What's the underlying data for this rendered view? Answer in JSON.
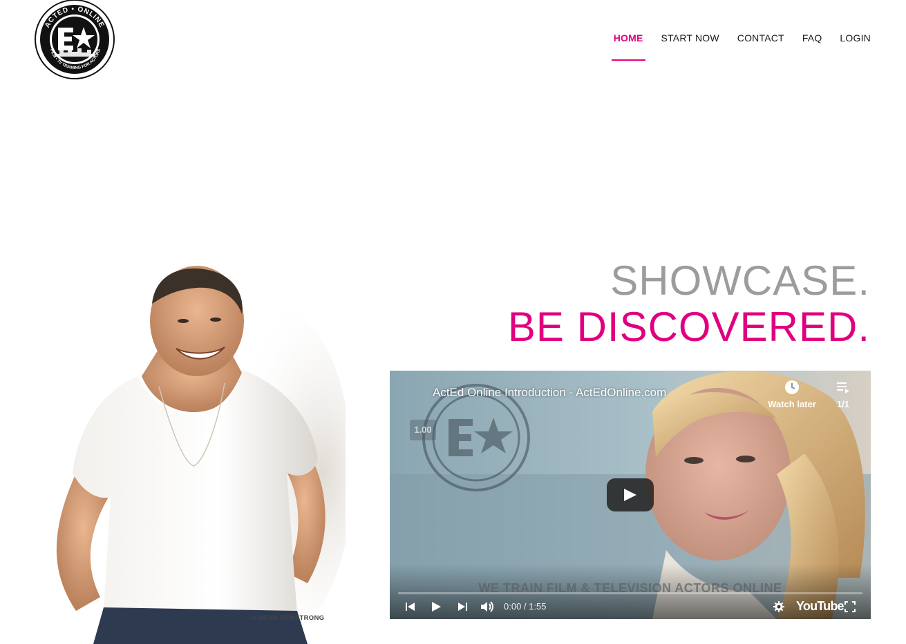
{
  "brand": {
    "logo_top_text": "ACTED • ONLINE",
    "logo_bottom_text": "FILM • TV TRAINING FOR ACTORS",
    "accent": "#e0007f"
  },
  "nav": [
    {
      "label": "HOME",
      "active": true
    },
    {
      "label": "START NOW",
      "active": false
    },
    {
      "label": "CONTACT",
      "active": false
    },
    {
      "label": "FAQ",
      "active": false
    },
    {
      "label": "LOGIN",
      "active": false
    }
  ],
  "hero": {
    "line1": "SHOWCASE.",
    "line2": "BE DISCOVERED.",
    "photo_credit": "w DEAN ARMSTRONG"
  },
  "video": {
    "title": "ActEd Online Introduction - ActEdOnline.com",
    "watch_later": "Watch later",
    "playlist_count": "1/1",
    "speed": "1.00",
    "overlay_caption": "WE TRAIN FILM & TELEVISION ACTORS ONLINE",
    "time": "0:00 / 1:55",
    "youtube_label": "YouTube"
  }
}
